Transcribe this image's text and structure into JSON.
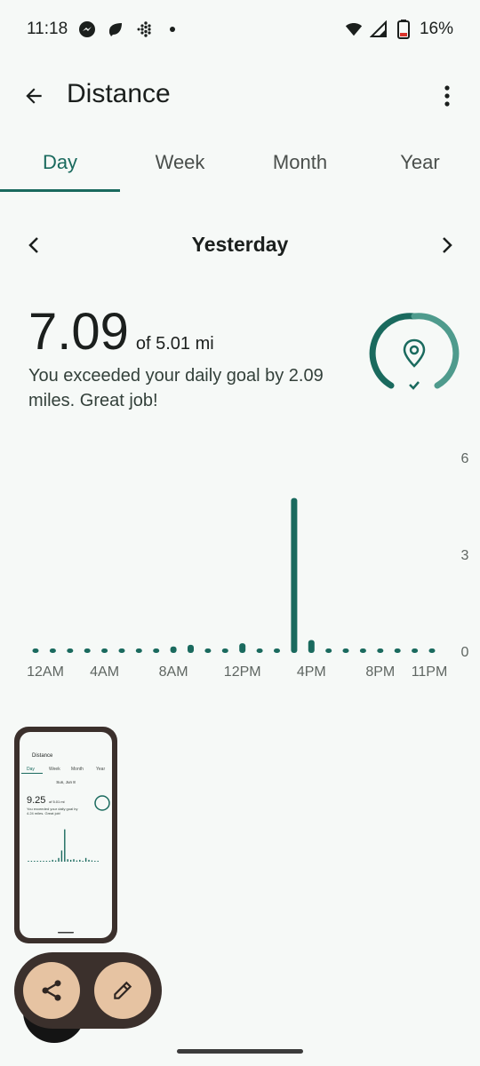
{
  "status_bar": {
    "time": "11:18",
    "notification_icons": [
      "messenger-icon",
      "leaf-icon",
      "fitbit-icon",
      "dot-icon"
    ],
    "battery": "16%",
    "icons": [
      "wifi-icon",
      "signal-icon",
      "battery-icon"
    ]
  },
  "app_bar": {
    "title": "Distance",
    "back_icon": "arrow-back-icon",
    "more_icon": "more-vert-icon"
  },
  "tabs": [
    {
      "label": "Day",
      "active": true
    },
    {
      "label": "Week",
      "active": false
    },
    {
      "label": "Month",
      "active": false
    },
    {
      "label": "Year",
      "active": false
    }
  ],
  "date_nav": {
    "label": "Yesterday"
  },
  "summary": {
    "value": "7.09",
    "goal": "of 5.01 mi",
    "message": "You exceeded your daily goal by 2.09 miles. Great job!",
    "goal_progress": 1.0
  },
  "chart_data": {
    "type": "bar",
    "bar_color": "#1a6a5e",
    "ylim": [
      0,
      6
    ],
    "y_ticks": [
      "6",
      "3",
      "0"
    ],
    "x_tick_labels": [
      "12AM",
      "4AM",
      "8AM",
      "12PM",
      "4PM",
      "8PM",
      "11PM"
    ],
    "x": [
      0,
      1,
      2,
      3,
      4,
      5,
      6,
      7,
      8,
      9,
      10,
      11,
      12,
      13,
      14,
      15,
      16,
      17,
      18,
      19,
      20,
      21,
      22,
      23
    ],
    "values": [
      0.05,
      0.05,
      0.05,
      0.05,
      0.05,
      0.05,
      0.05,
      0.05,
      0.2,
      0.25,
      0.1,
      0.05,
      0.3,
      0.05,
      0.05,
      4.8,
      0.4,
      0.05,
      0.05,
      0.05,
      0.05,
      0.05,
      0.05,
      0.05
    ]
  },
  "preview": {
    "title": "Distance",
    "tabs": [
      "Day",
      "Week",
      "Month",
      "Year"
    ],
    "date": "Sun, Jun 8",
    "value": "9.25",
    "goal": "of 5.01 mi",
    "message": "You exceeded your daily goal by 4.24 miles. Great job!"
  },
  "actions": {
    "share_icon": "share-icon",
    "edit_icon": "edit-pencil-icon"
  }
}
